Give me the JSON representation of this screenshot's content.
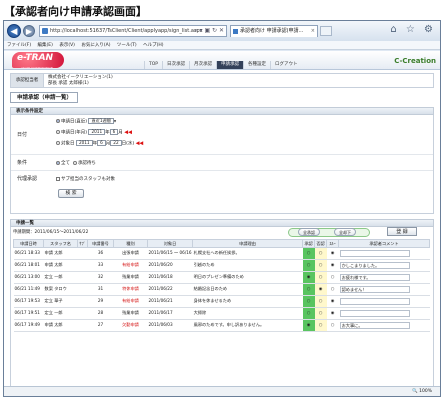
{
  "heading": "【承認者向け申請承認画面】",
  "browser": {
    "address": "http://localhost:51637/TsClient/Client/applyapp/sign_list.aspx",
    "tab_title": "承認者向け 申請承認(申請...",
    "window_icons": "⌂ ☆ ⚙",
    "menu": [
      "ファイル(F)",
      "編集(E)",
      "表示(V)",
      "お気に入り(A)",
      "ツール(T)",
      "ヘルプ(H)"
    ],
    "zoom": "100%"
  },
  "app": {
    "logo": "e-TRAN",
    "logo_sub": "ASAHI CORPORATION",
    "brand": "C-Creation",
    "nav": [
      "TOP",
      "日次承認",
      "月次承認",
      "申請承認",
      "各種設定",
      "ログアウト"
    ],
    "nav_active": 3
  },
  "user": {
    "label": "承認担当者",
    "company": "株式会社イークリエーション(1)",
    "dept": "部長 承認 太郎様(1)"
  },
  "page_title": "申請承認（申請一覧）",
  "conditions": {
    "header": "表示条件設定",
    "date_label": "日付",
    "opt1": "申請日(直近)",
    "opt1_sel": "直近1週間",
    "opt2": "申請日(年月)",
    "opt2_year": "2011",
    "opt2_month": "6",
    "opt3": "対象日",
    "opt3_year": "2011",
    "opt3_month": "6",
    "opt3_day": "22",
    "opt3_weekday": "日(水)",
    "year_unit": "年",
    "month_unit": "月",
    "day_unit": "日",
    "cond_label": "条件",
    "cond_all": "全て",
    "cond_pending": "承認待ち",
    "proxy_label": "代理承認",
    "proxy_text": "サブ担当のスタッフも対象",
    "search_button": "検 索"
  },
  "list": {
    "header": "申請一覧",
    "count": "申請期間：2011/06/15～2011/06/22",
    "approve_all": "全承認",
    "reject_all": "全却下",
    "save_button": "登 録",
    "columns": [
      "申請日時",
      "スタッフ名",
      "ｻﾌﾞ",
      "申請番号",
      "種別",
      "対象日",
      "申請理由",
      "承認",
      "否認",
      "ｽﾙｰ",
      "承認者コメント"
    ],
    "rows": [
      {
        "datetime": "06/21 18:33",
        "staff": "申請 太郎",
        "sub": "",
        "no": "36",
        "type": "出張申請",
        "red": false,
        "date": "2011/06/15 ～ 06/16",
        "reason": "札幌支社への新任挨拶。",
        "approve": "○",
        "reject": "○",
        "through": "◉",
        "comment": ""
      },
      {
        "datetime": "06/21 18:01",
        "staff": "申請 太郎",
        "sub": "",
        "no": "33",
        "type": "有給申請",
        "red": true,
        "date": "2011/06/20",
        "reason": "引越のため",
        "approve": "○",
        "reject": "○",
        "through": "◉",
        "comment": "かしこまりました。"
      },
      {
        "datetime": "06/21 13:00",
        "staff": "定立 一郎",
        "sub": "",
        "no": "32",
        "type": "残業申請",
        "red": false,
        "date": "2011/06/18",
        "reason": "明日のプレゼン準備のため",
        "approve": "◉",
        "reject": "○",
        "through": "○",
        "comment": "お疲れ様です。"
      },
      {
        "datetime": "06/21 11:49",
        "staff": "数案 タロウ",
        "sub": "",
        "no": "31",
        "type": "特休申請",
        "red": true,
        "date": "2011/06/22",
        "reason": "結婚記念日のため",
        "approve": "○",
        "reject": "◉",
        "through": "○",
        "comment": "認めません！"
      },
      {
        "datetime": "06/17 19:53",
        "staff": "定立 華子",
        "sub": "",
        "no": "29",
        "type": "有給申請",
        "red": true,
        "date": "2011/06/21",
        "reason": "身体を休ませるため",
        "approve": "○",
        "reject": "○",
        "through": "◉",
        "comment": ""
      },
      {
        "datetime": "06/17 19:51",
        "staff": "定立 一郎",
        "sub": "",
        "no": "28",
        "type": "残業申請",
        "red": false,
        "date": "2011/06/17",
        "reason": "大掃除",
        "approve": "○",
        "reject": "○",
        "through": "◉",
        "comment": ""
      },
      {
        "datetime": "06/17 19:49",
        "staff": "申請 太郎",
        "sub": "",
        "no": "27",
        "type": "欠勤申請",
        "red": true,
        "date": "2011/06/03",
        "reason": "風邪のためです。申し訳ありません。",
        "approve": "◉",
        "reject": "○",
        "through": "○",
        "comment": "お大事に。"
      }
    ]
  }
}
